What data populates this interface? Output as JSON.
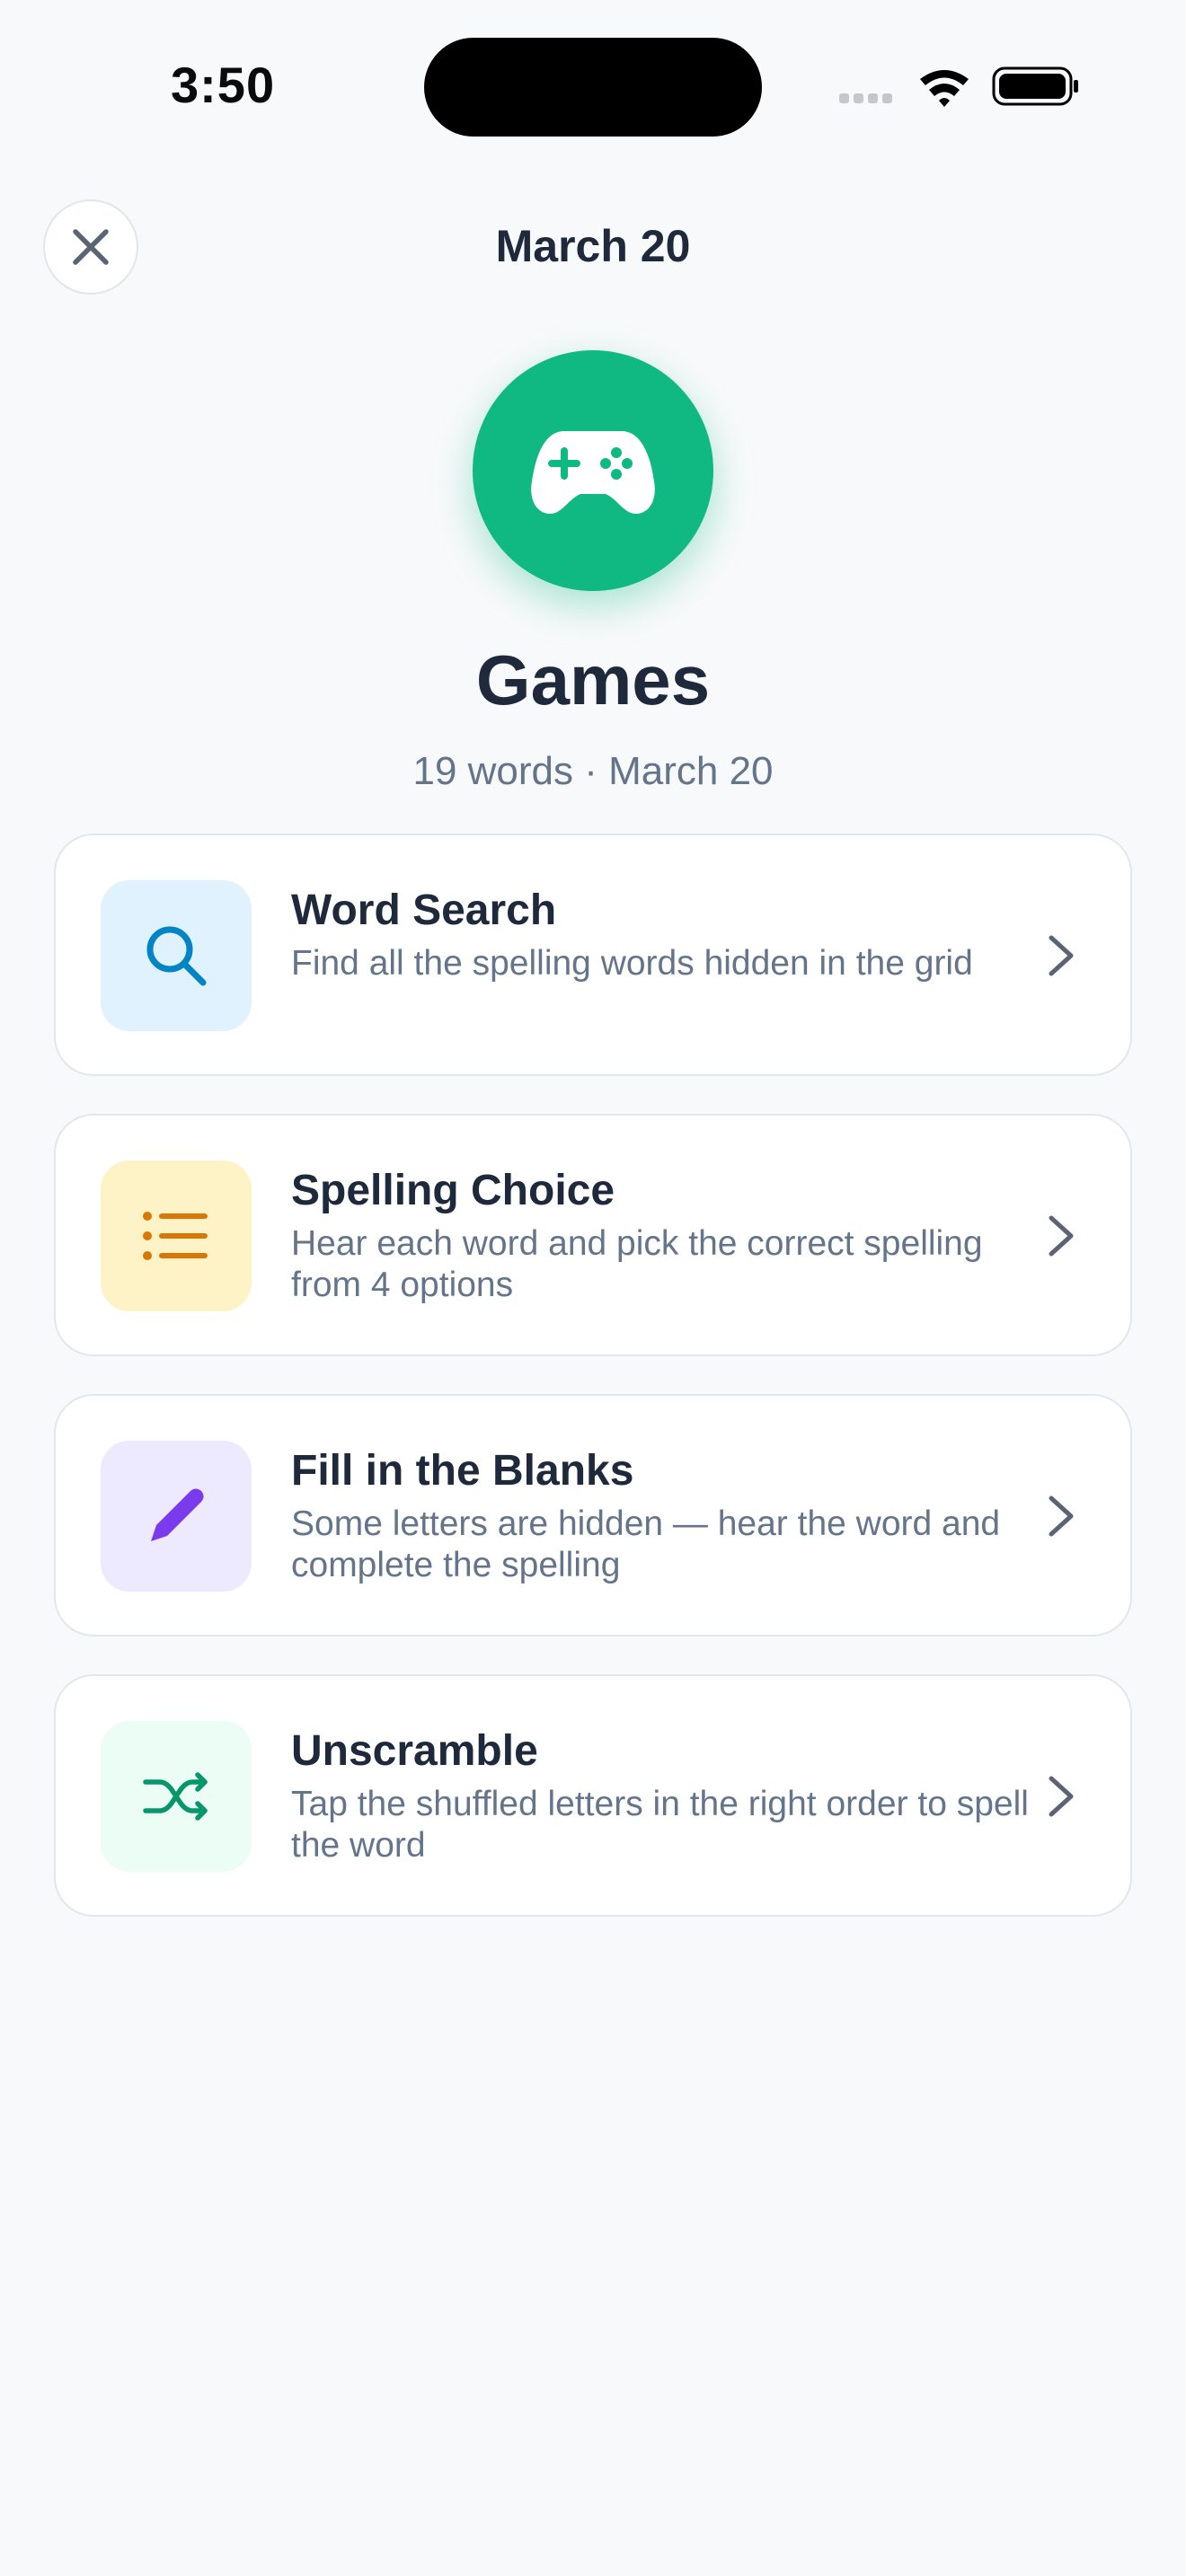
{
  "status_bar": {
    "time": "3:50"
  },
  "header": {
    "title": "March 20",
    "close_icon": "close-icon"
  },
  "hero": {
    "icon": "gamepad-icon",
    "title": "Games",
    "subtitle": "19 words · March 20",
    "accent": "#10b981"
  },
  "games": [
    {
      "title": "Word Search",
      "description": "Find all the spelling words hidden in the grid",
      "icon": "search-icon",
      "icon_bg": "#e0f2fe",
      "icon_color": "#0284c7"
    },
    {
      "title": "Spelling Choice",
      "description": "Hear each word and pick the correct spelling from 4 options",
      "icon": "list-icon",
      "icon_bg": "#fef3c7",
      "icon_color": "#d97706"
    },
    {
      "title": "Fill in the Blanks",
      "description": "Some letters are hidden — hear the word and complete the spelling",
      "icon": "pencil-icon",
      "icon_bg": "#ede9fe",
      "icon_color": "#7c3aed"
    },
    {
      "title": "Unscramble",
      "description": "Tap the shuffled letters in the right order to spell the word",
      "icon": "shuffle-icon",
      "icon_bg": "#ecfdf5",
      "icon_color": "#059669"
    }
  ]
}
